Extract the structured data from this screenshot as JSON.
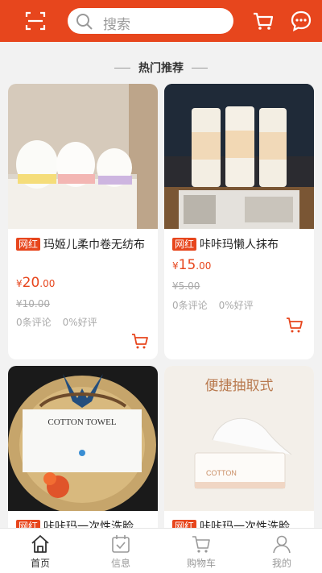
{
  "header": {
    "search_placeholder": "搜索"
  },
  "section": {
    "title": "热门推荐"
  },
  "products": [
    {
      "badge": "网红",
      "title": "玛姬儿柔巾卷无纺布",
      "price_currency": "¥",
      "price_int": "20",
      "price_dec": ".00",
      "original_price": "¥10.00",
      "comments": "0条评论",
      "rating": "0%好评"
    },
    {
      "badge": "网红",
      "title": "咔咔玛懒人抹布",
      "price_currency": "¥",
      "price_int": "15",
      "price_dec": ".00",
      "original_price": "¥5.00",
      "comments": "0条评论",
      "rating": "0%好评"
    },
    {
      "badge": "网红",
      "title": "咔咔玛一次性洗脸",
      "image_text": "COTTON TOWEL"
    },
    {
      "badge": "网红",
      "title": "咔咔玛一次性洗脸",
      "image_text": "便捷抽取式",
      "image_subtext": "COTTON"
    }
  ],
  "tabbar": [
    {
      "label": "首页",
      "icon": "home-icon"
    },
    {
      "label": "信息",
      "icon": "calendar-icon"
    },
    {
      "label": "购物车",
      "icon": "cart-icon"
    },
    {
      "label": "我的",
      "icon": "user-icon"
    }
  ],
  "colors": {
    "accent": "#e7461d",
    "background": "#f2f2f2"
  }
}
